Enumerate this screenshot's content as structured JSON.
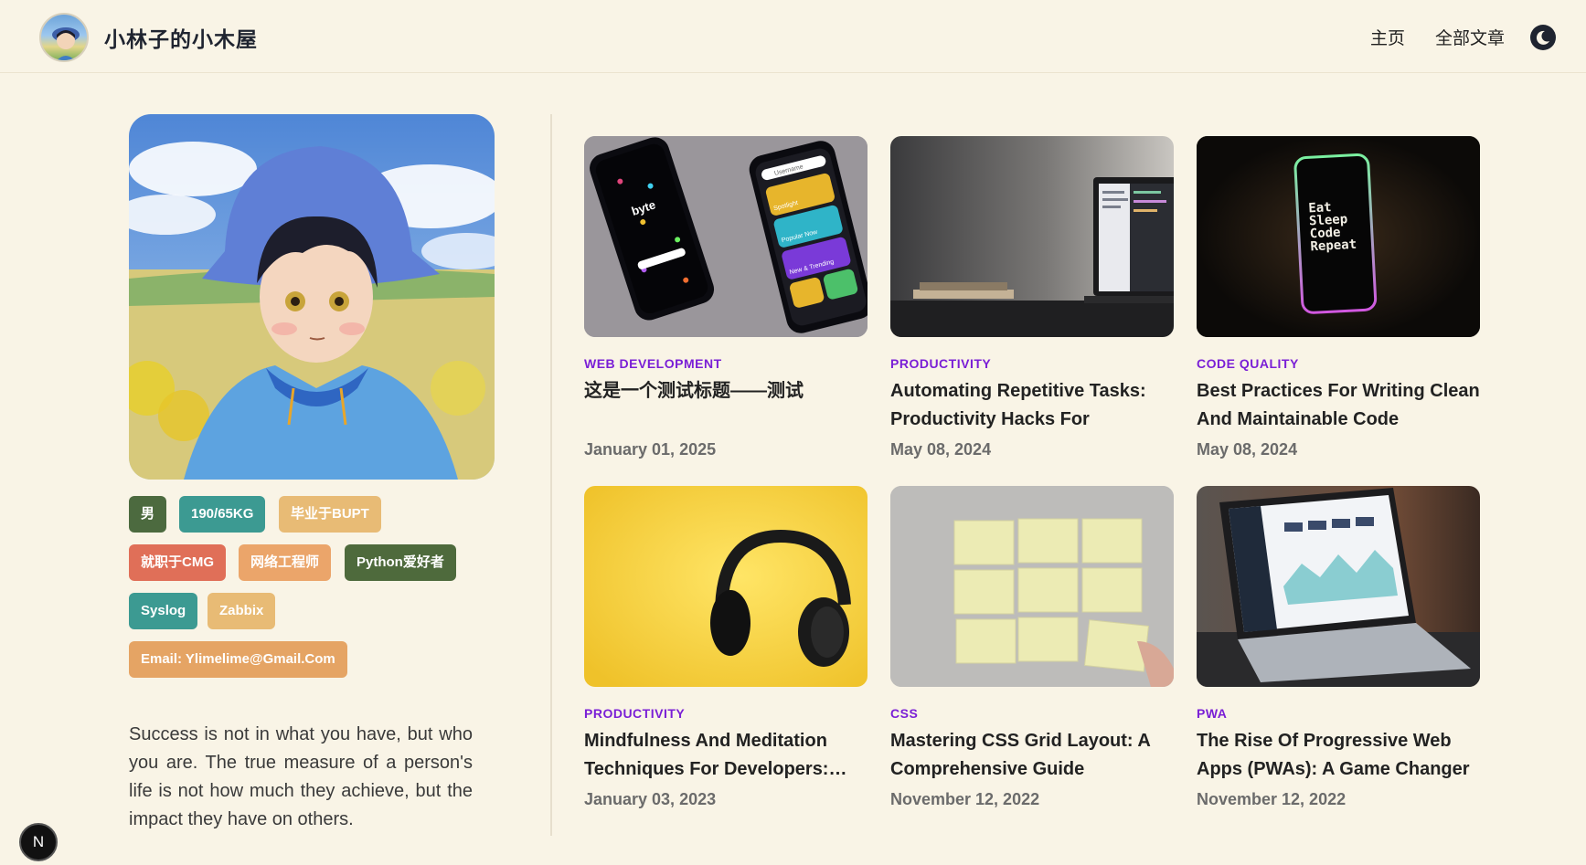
{
  "header": {
    "site_title": "小林子的小木屋",
    "nav": {
      "home": "主页",
      "all_articles": "全部文章"
    },
    "theme_icon": "moon-icon"
  },
  "profile": {
    "tags": [
      {
        "label": "男",
        "color": "#4c6a3f"
      },
      {
        "label": "190/65KG",
        "color": "#3c9a92"
      },
      {
        "label": "毕业于BUPT",
        "color": "#e8bb75"
      },
      {
        "label": "就职于CMG",
        "color": "#e06f58"
      },
      {
        "label": "网络工程师",
        "color": "#eba56a"
      },
      {
        "label": "Python爱好者",
        "color": "#4e6a3c"
      },
      {
        "label": "Syslog",
        "color": "#3c9a92"
      },
      {
        "label": "Zabbix",
        "color": "#e8bb75"
      },
      {
        "label": "Email: Ylimelime@Gmail.Com",
        "color": "#e5a464"
      }
    ],
    "quote": "Success is not in what you have, but who you are. The true measure of a person's life is not how much they achieve, but the impact they have on others."
  },
  "posts": [
    {
      "category": "WEB DEVELOPMENT",
      "title": "这是一个测试标题——测试",
      "date": "January 01, 2025"
    },
    {
      "category": "PRODUCTIVITY",
      "title": "Automating Repetitive Tasks: Productivity Hacks For Developers",
      "date": "May 08, 2024"
    },
    {
      "category": "CODE QUALITY",
      "title": "Best Practices For Writing Clean And Maintainable Code",
      "date": "May 08, 2024"
    },
    {
      "category": "PRODUCTIVITY",
      "title": "Mindfulness And Meditation Techniques For Developers:…",
      "date": "January 03, 2023"
    },
    {
      "category": "CSS",
      "title": "Mastering CSS Grid Layout: A Comprehensive Guide",
      "date": "November 12, 2022"
    },
    {
      "category": "PWA",
      "title": "The Rise Of Progressive Web Apps (PWAs): A Game Changer In Web…",
      "date": "November 12, 2022"
    }
  ],
  "phone_art": {
    "brand": "byte",
    "search": "Username",
    "bands": [
      "Spotlight",
      "Popular Now",
      "New & Trending"
    ]
  },
  "neon_phone": {
    "lines": [
      "Eat",
      "Sleep",
      "Code",
      "Repeat"
    ]
  },
  "next_badge": "N"
}
